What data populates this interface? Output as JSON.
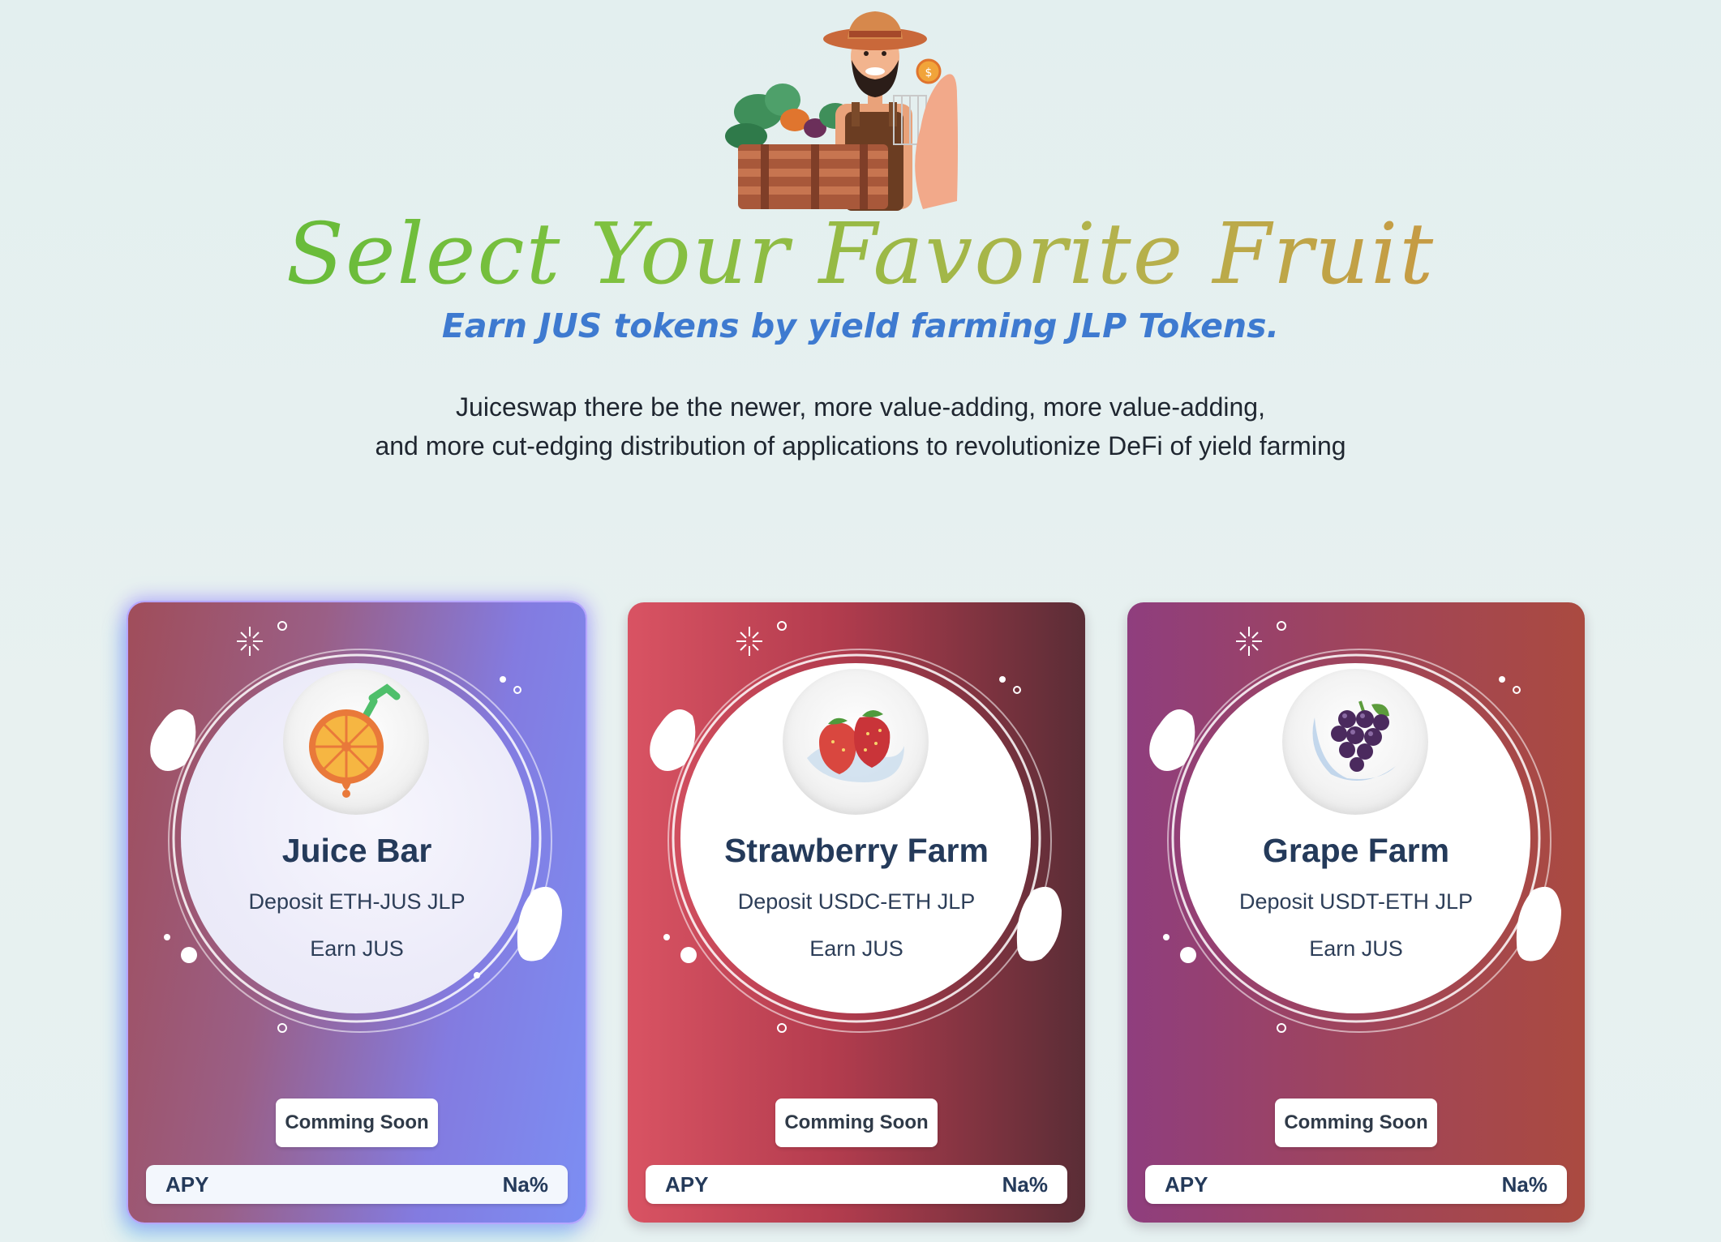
{
  "hero": {
    "illustration_icon": "farmer-with-crate-icon",
    "title": "Select Your Favorite Fruit",
    "subtitle": "Earn JUS tokens by yield farming JLP Tokens.",
    "description_line1": "Juiceswap there be the newer, more value-adding, more value-adding,",
    "description_line2": "and more cut-edging distribution of applications to revolutionize DeFi of yield farming"
  },
  "farms": [
    {
      "icon": "orange-juice-icon",
      "name": "Juice Bar",
      "deposit": "Deposit ETH-JUS JLP",
      "earn": "Earn JUS",
      "button_label": "Comming Soon",
      "apy_label": "APY",
      "apy_value": "Na%"
    },
    {
      "icon": "strawberry-icon",
      "name": "Strawberry Farm",
      "deposit": "Deposit USDC-ETH JLP",
      "earn": "Earn JUS",
      "button_label": "Comming Soon",
      "apy_label": "APY",
      "apy_value": "Na%"
    },
    {
      "icon": "grape-icon",
      "name": "Grape Farm",
      "deposit": "Deposit USDT-ETH JLP",
      "earn": "Earn JUS",
      "button_label": "Comming Soon",
      "apy_label": "APY",
      "apy_value": "Na%"
    }
  ],
  "colors": {
    "title_gradient": [
      "#55b635",
      "#b5b24c",
      "#d6863c"
    ],
    "subtitle": "#3e7ad0",
    "card_text": "#243a5a"
  }
}
